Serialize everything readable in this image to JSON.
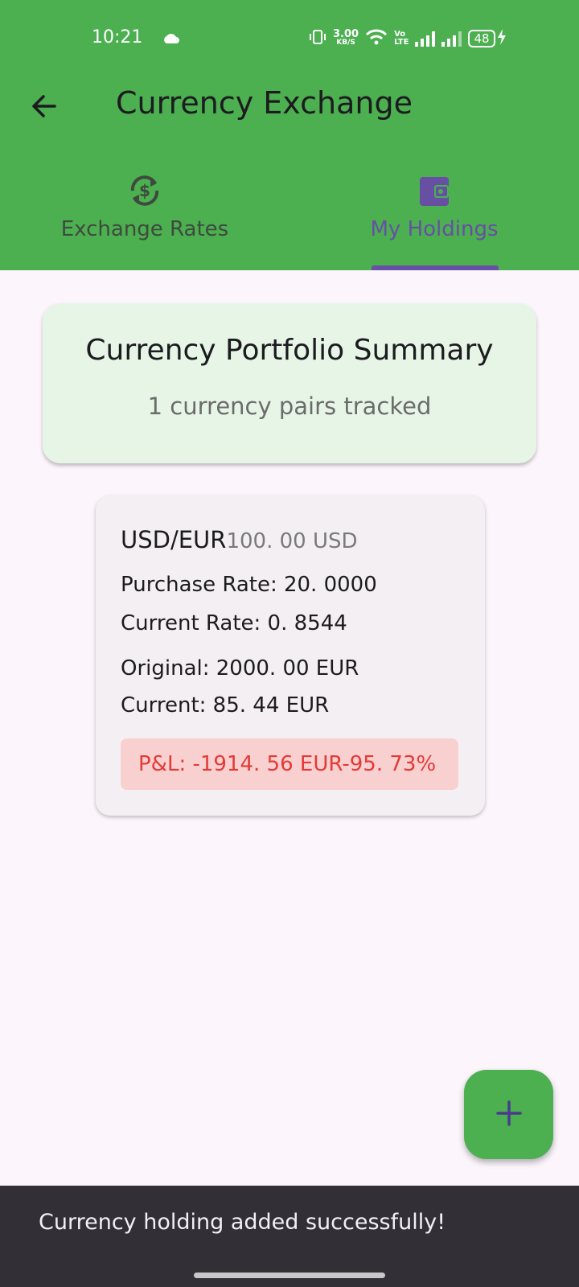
{
  "status_bar": {
    "time": "10:21",
    "net_speed": "3.00",
    "net_unit": "KB/S",
    "volte_top": "Vo",
    "volte_bottom": "LTE",
    "battery": "48",
    "icons": [
      "cloud-icon",
      "vibrate-icon",
      "wifi-icon",
      "signal-icon",
      "signal-icon",
      "battery-icon",
      "charging-icon"
    ]
  },
  "app_bar": {
    "title": "Currency Exchange",
    "back_icon": "arrow-back-icon"
  },
  "tabs": [
    {
      "label": "Exchange Rates",
      "icon": "currency-exchange-icon",
      "selected": false
    },
    {
      "label": "My Holdings",
      "icon": "wallet-icon",
      "selected": true
    }
  ],
  "summary": {
    "title": "Currency Portfolio Summary",
    "subtitle": "1 currency pairs tracked"
  },
  "holding": {
    "pair": "USD/EUR",
    "amount": "100. 00 USD",
    "purchase_rate": "Purchase Rate: 20. 0000",
    "current_rate": "Current Rate: 0. 8544",
    "original": "Original: 2000. 00 EUR",
    "current": "Current: 85. 44 EUR",
    "pl": "P&L: -1914. 56 EUR-95. 73%"
  },
  "fab": {
    "icon": "add-icon"
  },
  "snackbar": {
    "message": "Currency holding added successfully!"
  },
  "colors": {
    "primary": "#4caf50",
    "accent": "#6750a4",
    "loss_text": "#e53935",
    "loss_bg": "#f8d0d0",
    "summary_bg": "#e7f5e7"
  }
}
